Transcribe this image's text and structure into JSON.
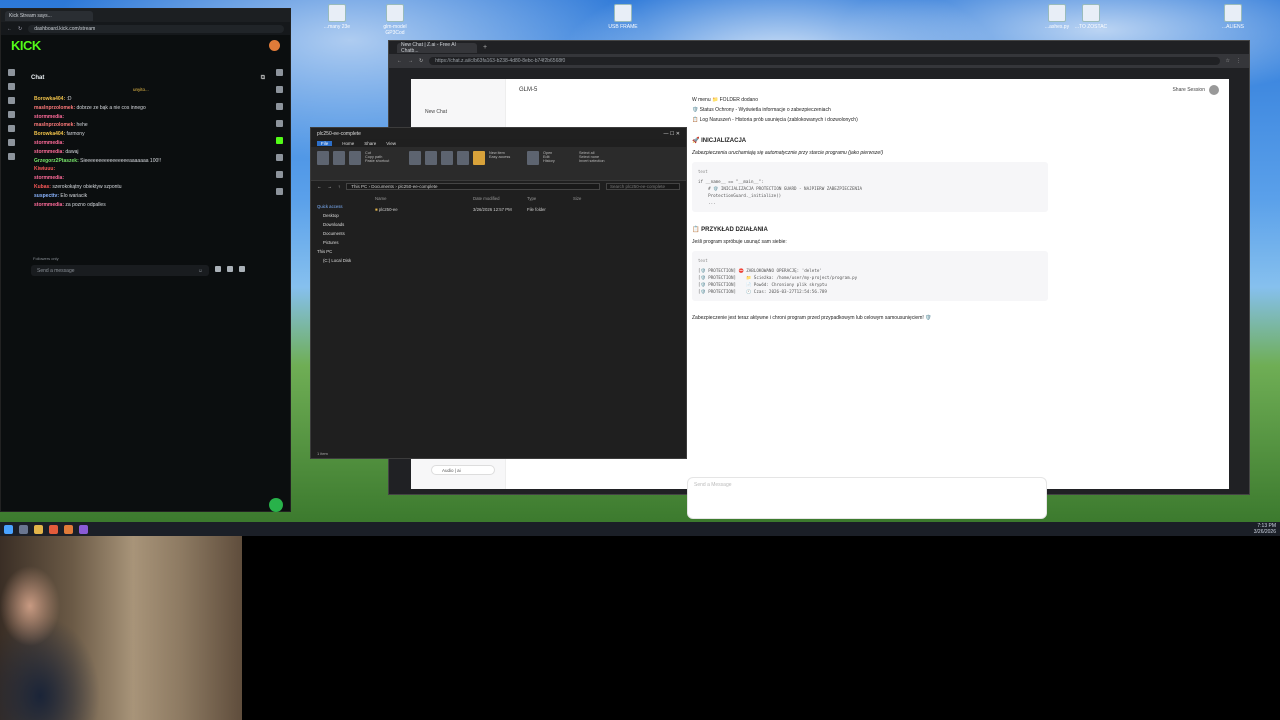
{
  "desktop": {
    "icons": [
      {
        "label": "...many 23e"
      },
      {
        "label": "glm-model GP3Cod"
      },
      {
        "label": "USB FRAME"
      },
      {
        "label": "...ashes.py"
      },
      {
        "label": "...TO ZOSTAC"
      },
      {
        "label": "...ALIENS"
      }
    ]
  },
  "taskbar": {
    "time": "7:13 PM",
    "date": "3/26/2026"
  },
  "kick": {
    "tab_title": "Kick Stream says...",
    "url": "dashboard.kick.com/stream",
    "logo": "KICK",
    "chat_title": "Chat",
    "pinned": "unyito...",
    "messages": [
      {
        "user": "Borowka404:",
        "text": ":D",
        "color": "#f0c24a"
      },
      {
        "user": "maslnprzolomek:",
        "text": "dobrze ze bąk a nie cos innego",
        "color": "#ff7a7a"
      },
      {
        "user": "stormmedia:",
        "text": "",
        "color": "#ff6b9a"
      },
      {
        "user": "maslnprzolomek:",
        "text": "hehe",
        "color": "#ff7a7a"
      },
      {
        "user": "Borowka404:",
        "text": "farmony",
        "color": "#f0c24a"
      },
      {
        "user": "stormmedia:",
        "text": "",
        "color": "#ff6b9a"
      },
      {
        "user": "stormmedia:",
        "text": "dawaj",
        "color": "#ff6b9a"
      },
      {
        "user": "Grzegorz2Ptaszek:",
        "text": "Sieeeeeeeeeeeeeeeeaaaaaaa 100!!",
        "color": "#77e26a"
      },
      {
        "user": "Kiwiuuu:",
        "text": "",
        "color": "#ff5a5a"
      },
      {
        "user": "stormmedia:",
        "text": "",
        "color": "#ff6b9a"
      },
      {
        "user": "Kubas:",
        "text": "szerokokątny obiektyw szpontu",
        "color": "#ff5a5a"
      },
      {
        "user": "suspecttv:",
        "text": "Elo wariacik",
        "color": "#8ab4ff"
      },
      {
        "user": "stormmedia:",
        "text": "za pozno odpalles",
        "color": "#ff6b9a"
      }
    ],
    "followers_only": "Followers only",
    "input_placeholder": "Send a message"
  },
  "glm": {
    "tab_title": "New Chat | Z.ai - Free AI Chatb...",
    "url": "https://chat.z.ai/c/b63fa163-b238-4d80-8ebc-b74f2b6568f0",
    "new_chat": "New Chat",
    "model": "GLM-5",
    "share": "Share Session",
    "audio": "Audio | ai",
    "top_line": "W menu 📁 FOLDER dodano",
    "bullets": [
      "🛡️ Status Ochrony - Wyświetla informacje o zabezpieczeniach",
      "📋 Log Naruszeń - Historia prób usunięcia (zablokowanych i dozwolonych)"
    ],
    "section1": "🚀 INICJALIZACJA",
    "section1_text": "Zabezpieczenia uruchamiają się automatycznie przy starcie programu (jako pierwsze!)",
    "code1_lang": "text",
    "code1": "if __name__ == \"__main__\":\n    # 🛡️ INICJALIZACJA PROTECTION GUARD - NAJPIERW ZABEZPIECZENIA\n    ProtectionGuard._initialize()\n    ...",
    "section2": "📋 PRZYKŁAD DZIAŁANIA",
    "section2_text": "Jeśli program spróbuje usunąć sam siebie:",
    "code2_lang": "text",
    "code2": "[🛡️ PROTECTION] ⛔ ZABLOKOWANO OPERACJĘ: 'delete'\n[🛡️ PROTECTION]    📁 Ścieżka: /home/user/my-project/program.py\n[🛡️ PROTECTION]    📄 Powód: Chroniony plik skryptu\n[🛡️ PROTECTION]    🕐 Czas: 2026-03-27T12:54:56.789",
    "footer_text": "Zabezpieczenie jest teraz aktywne i chroni program przed przypadkowym lub celowym samousunięciem! 🛡️",
    "composer_placeholder": "Send a Message"
  },
  "explorer": {
    "title": "plc250-ee-complete",
    "menu": [
      "File",
      "Home",
      "Share",
      "View"
    ],
    "ribbon": [
      "Pin to Quick access",
      "Copy",
      "Paste",
      "Cut",
      "Copy path",
      "Paste shortcut",
      "Move to",
      "Copy to",
      "Delete",
      "Rename",
      "New folder",
      "New item",
      "Easy access",
      "Properties",
      "Open",
      "Edit",
      "History",
      "Select all",
      "Select none",
      "Invert selection"
    ],
    "groups": [
      "Clipboard",
      "Organize",
      "New",
      "Open",
      "Select"
    ],
    "path": [
      "This PC",
      "Documents",
      "plc250-ee-complete"
    ],
    "search_placeholder": "Search plc250-ee-complete",
    "nav": [
      "Quick access",
      "Desktop",
      "Downloads",
      "Documents",
      "Pictures",
      "This PC",
      "(C:) Local Disk"
    ],
    "columns": [
      "Name",
      "Date modified",
      "Type",
      "Size"
    ],
    "rows": [
      {
        "name": "plc250-ee",
        "date": "3/26/2026 12:57 PM",
        "type": "File folder",
        "size": ""
      }
    ],
    "status": "1 item"
  }
}
